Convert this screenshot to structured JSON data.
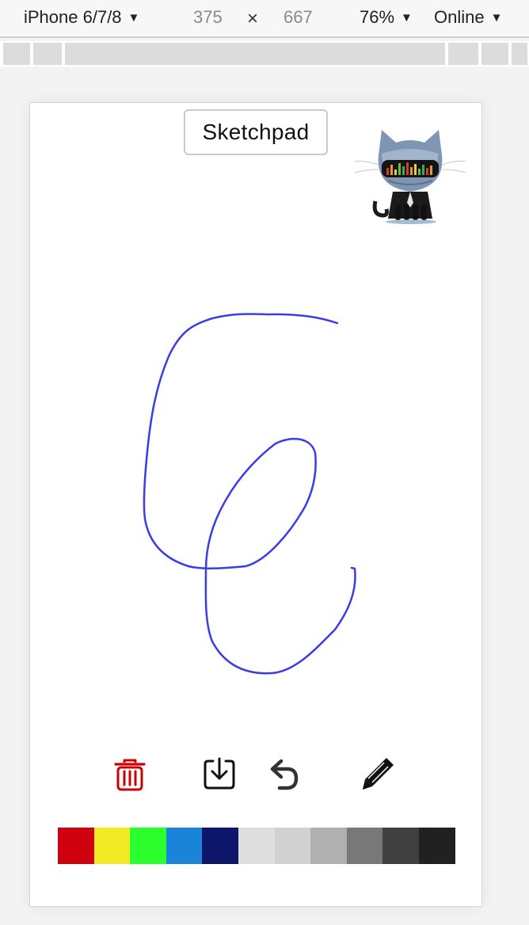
{
  "devtools": {
    "device": "iPhone 6/7/8",
    "width": "375",
    "times": "×",
    "height": "667",
    "zoom": "76%",
    "network": "Online",
    "caret": "▼"
  },
  "app": {
    "title": "Sketchpad"
  },
  "toolbar": {
    "trash_icon": "trash-icon",
    "save_icon": "download-icon",
    "undo_icon": "undo-icon",
    "pen_icon": "pencil-icon",
    "trash_color": "#cc0000",
    "icon_color": "#111111"
  },
  "palette": {
    "colors": [
      "#d0000f",
      "#f2ea22",
      "#2cff2e",
      "#1a85d8",
      "#0e166b",
      "#dedede",
      "#d1d1d1",
      "#b0b0b0",
      "#787878",
      "#404040",
      "#212121"
    ]
  },
  "stroke": {
    "color": "#3b3be8"
  }
}
